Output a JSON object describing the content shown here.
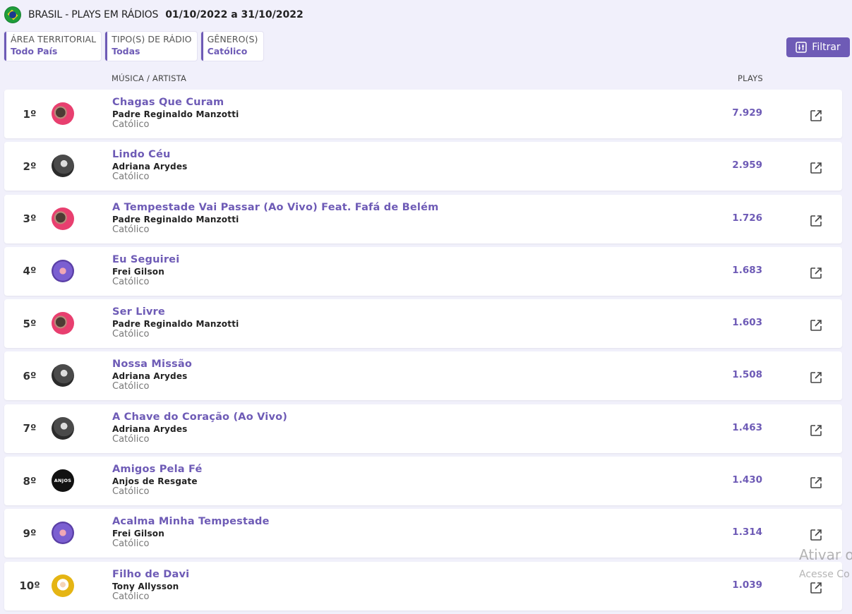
{
  "header": {
    "title": "BRASIL - PLAYS EM RÁDIOS",
    "dates": "01/10/2022 a 31/10/2022",
    "flag_icon": "brazil-flag-icon"
  },
  "filters": [
    {
      "label": "ÁREA TERRITORIAL",
      "value": "Todo País"
    },
    {
      "label": "TIPO(S) DE RÁDIO",
      "value": "Todas"
    },
    {
      "label": "GÊNERO(S)",
      "value": "Católico"
    }
  ],
  "filter_button": {
    "label": "Filtrar",
    "icon": "sliders-icon"
  },
  "columns": {
    "music": "MÚSICA / ARTISTA",
    "plays": "PLAYS"
  },
  "rows": [
    {
      "rank": "1º",
      "song": "Chagas Que Curam",
      "artist": "Padre Reginaldo Manzotti",
      "genre": "Católico",
      "plays": "7.929"
    },
    {
      "rank": "2º",
      "song": "Lindo Céu",
      "artist": "Adriana Arydes",
      "genre": "Católico",
      "plays": "2.959"
    },
    {
      "rank": "3º",
      "song": "A Tempestade Vai Passar (Ao Vivo) Feat. Fafá de Belém",
      "artist": "Padre Reginaldo Manzotti",
      "genre": "Católico",
      "plays": "1.726"
    },
    {
      "rank": "4º",
      "song": "Eu Seguirei",
      "artist": "Frei Gilson",
      "genre": "Católico",
      "plays": "1.683"
    },
    {
      "rank": "5º",
      "song": "Ser Livre",
      "artist": "Padre Reginaldo Manzotti",
      "genre": "Católico",
      "plays": "1.603"
    },
    {
      "rank": "6º",
      "song": "Nossa Missão",
      "artist": "Adriana Arydes",
      "genre": "Católico",
      "plays": "1.508"
    },
    {
      "rank": "7º",
      "song": "A Chave do Coração (Ao Vivo)",
      "artist": "Adriana Arydes",
      "genre": "Católico",
      "plays": "1.463"
    },
    {
      "rank": "8º",
      "song": "Amigos Pela Fé",
      "artist": "Anjos de Resgate",
      "genre": "Católico",
      "plays": "1.430",
      "avatar_text": "ANJOS"
    },
    {
      "rank": "9º",
      "song": "Acalma Minha Tempestade",
      "artist": "Frei Gilson",
      "genre": "Católico",
      "plays": "1.314"
    },
    {
      "rank": "10º",
      "song": "Filho de Davi",
      "artist": "Tony Allysson",
      "genre": "Católico",
      "plays": "1.039"
    }
  ],
  "watermark": {
    "line1": "Ativar o",
    "line2": "Acesse Co"
  },
  "colors": {
    "accent": "#6e5bb6",
    "background": "#f1f0fb"
  }
}
